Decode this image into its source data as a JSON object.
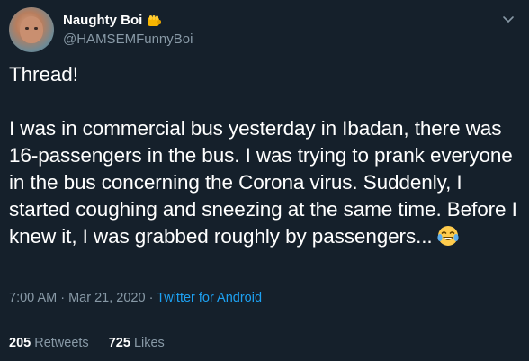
{
  "user": {
    "display_name": "Naughty Boi",
    "handle": "@HAMSEMFunnyBoi",
    "name_emoji": "fist-icon"
  },
  "tweet": {
    "line1": "Thread!",
    "body": "I was in commercial bus yesterday in Ibadan, there was 16-passengers in the bus. I was trying to prank everyone in the bus concerning the Corona virus. Suddenly, I started coughing and sneezing at the same time. Before I knew it, I was grabbed roughly by passengers...",
    "trailing_emoji": "tears-of-joy-icon"
  },
  "meta": {
    "time": "7:00 AM",
    "separator1": " · ",
    "date": "Mar 21, 2020",
    "separator2": " · ",
    "source": "Twitter for Android"
  },
  "stats": {
    "retweets_count": "205",
    "retweets_label": "Retweets",
    "likes_count": "725",
    "likes_label": "Likes"
  },
  "colors": {
    "background": "#15202b",
    "text": "#ffffff",
    "secondary": "#8899a6",
    "link": "#1da1f2",
    "divider": "#38444d"
  }
}
